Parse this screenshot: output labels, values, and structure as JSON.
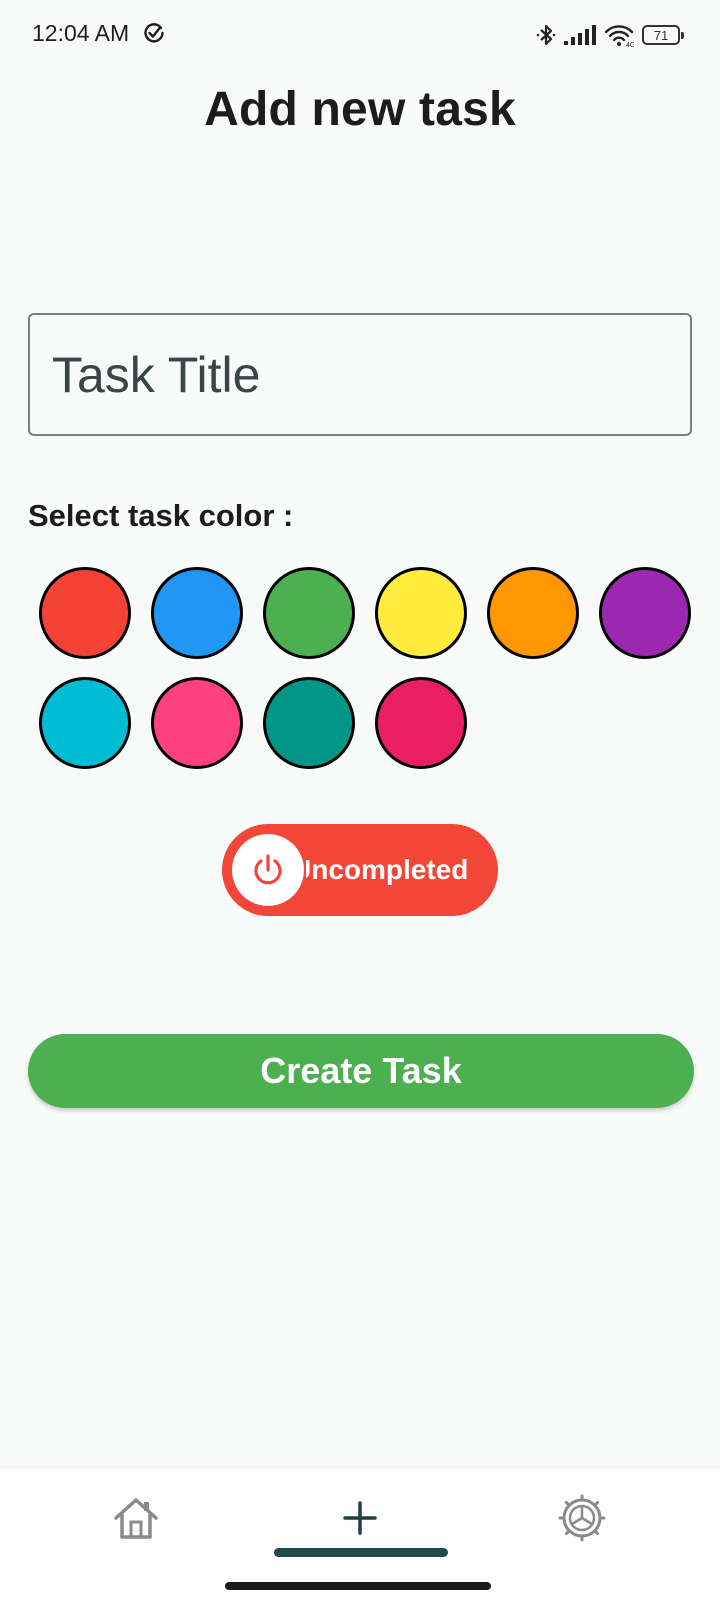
{
  "status_bar": {
    "time": "12:04 AM",
    "battery": "71",
    "icons": [
      "check-circle-icon",
      "bluetooth-icon",
      "signal-icon",
      "wifi-icon",
      "battery-icon"
    ]
  },
  "header": {
    "title": "Add new task"
  },
  "form": {
    "title_placeholder": "Task Title",
    "title_value": "",
    "color_label": "Select task color :",
    "colors": [
      "#f44336",
      "#2196f3",
      "#4caf50",
      "#ffeb3b",
      "#ff9800",
      "#9c27b0",
      "#00bcd4",
      "#ff4081",
      "#009688",
      "#e91e63"
    ],
    "status_toggle_label": "Uncompleted",
    "status_toggle_color": "#f24638",
    "create_button_label": "Create Task",
    "create_button_color": "#4caf50"
  },
  "bottom_nav": {
    "items": [
      {
        "icon": "home-icon",
        "active": false
      },
      {
        "icon": "plus-icon",
        "active": true
      },
      {
        "icon": "settings-icon",
        "active": false
      }
    ]
  }
}
